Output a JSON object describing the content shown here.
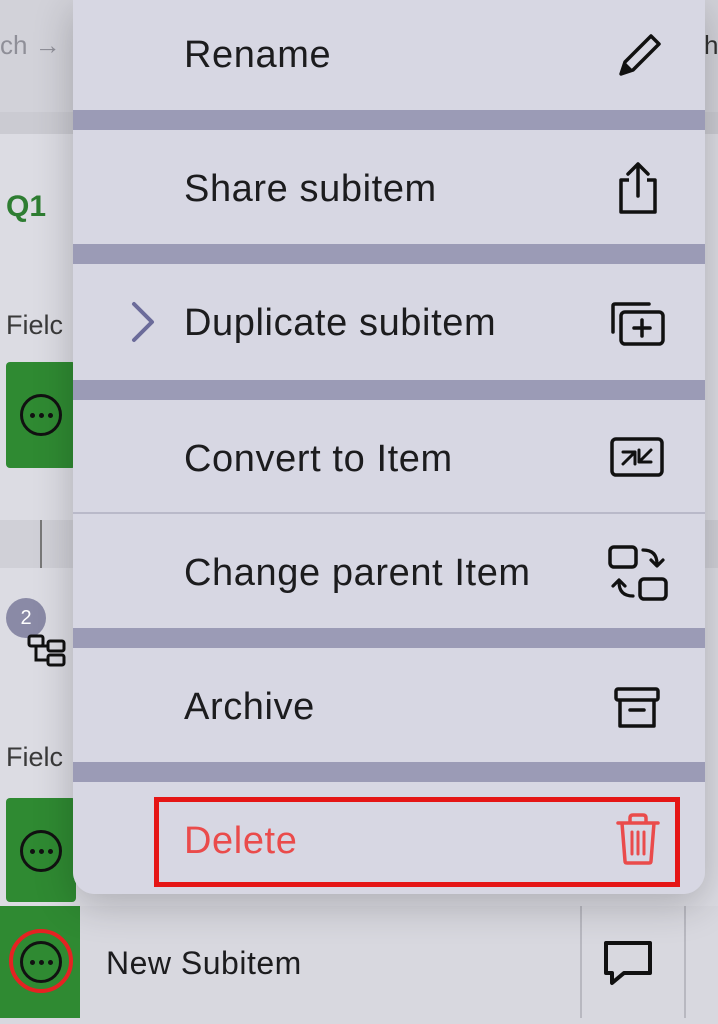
{
  "background": {
    "breadcrumb_fragment": "ch →",
    "right_edge_fragment": "h",
    "group_title": "Q1",
    "field_label_1": "Fielc",
    "field_label_2": "Fielc",
    "subitems_count": "2",
    "bottom_row": {
      "name": "New Subitem"
    }
  },
  "menu": {
    "items": [
      {
        "label": "Rename",
        "icon": "pencil-icon"
      },
      {
        "label": "Share subitem",
        "icon": "share-icon"
      },
      {
        "label": "Duplicate subitem",
        "icon": "duplicate-icon",
        "has_submenu": true
      },
      {
        "label": "Convert to Item",
        "icon": "convert-icon"
      },
      {
        "label": "Change parent Item",
        "icon": "change-parent-icon"
      },
      {
        "label": "Archive",
        "icon": "archive-icon"
      },
      {
        "label": "Delete",
        "icon": "trash-icon",
        "destructive": true,
        "highlighted": true
      }
    ]
  },
  "colors": {
    "accent_green": "#2f8a32",
    "delete_red": "#ea4b4b",
    "highlight_red": "#e51515",
    "menu_bg": "#d7d7e3",
    "separator": "#9b9bb6"
  }
}
